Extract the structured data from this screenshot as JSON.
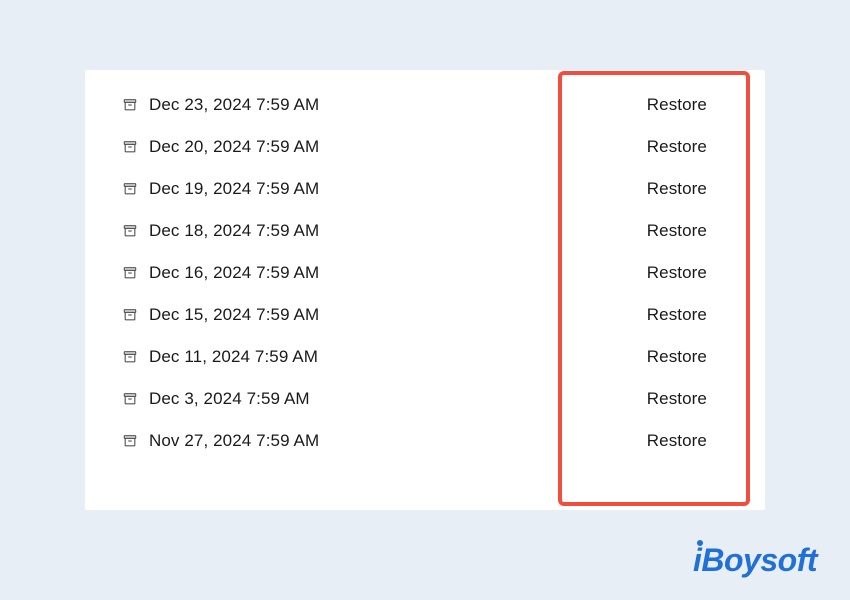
{
  "backups": [
    {
      "date": "Dec 23, 2024 7:59 AM",
      "action": "Restore"
    },
    {
      "date": "Dec 20, 2024 7:59 AM",
      "action": "Restore"
    },
    {
      "date": "Dec 19, 2024 7:59 AM",
      "action": "Restore"
    },
    {
      "date": "Dec 18, 2024 7:59 AM",
      "action": "Restore"
    },
    {
      "date": "Dec 16, 2024 7:59 AM",
      "action": "Restore"
    },
    {
      "date": "Dec 15, 2024 7:59 AM",
      "action": "Restore"
    },
    {
      "date": "Dec 11, 2024 7:59 AM",
      "action": "Restore"
    },
    {
      "date": "Dec 3, 2024 7:59 AM",
      "action": "Restore"
    },
    {
      "date": "Nov 27, 2024 7:59 AM",
      "action": "Restore"
    }
  ],
  "brand": "iBoysoft"
}
